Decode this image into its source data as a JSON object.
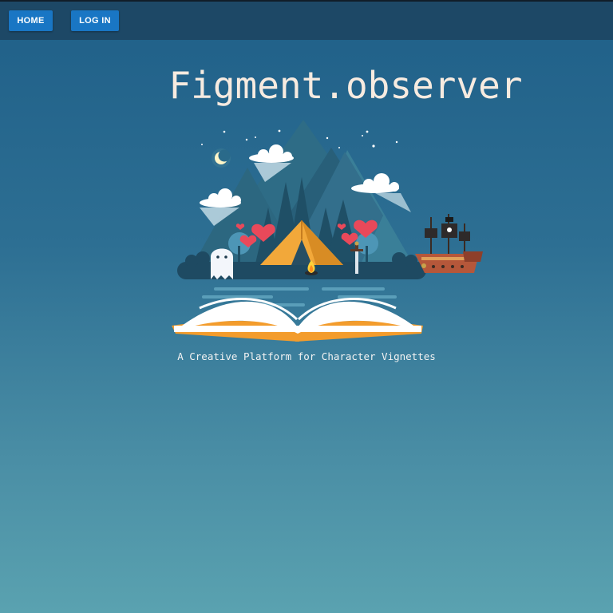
{
  "nav": {
    "home_label": "HOME",
    "login_label": "LOG IN"
  },
  "header": {
    "site_title": "Figment.observer"
  },
  "hero": {
    "tagline": "A Creative Platform for Character Vignettes"
  },
  "colors": {
    "topbar": "#1d4866",
    "button": "#1976c4",
    "title_text": "#f7ebe0",
    "tent": "#f2a83a",
    "book_cover": "#f39c2c",
    "heart": "#e9495a"
  },
  "icons": [
    "moon-icon",
    "star-icon",
    "cloud-icon",
    "tent-icon",
    "ghost-icon",
    "sword-icon",
    "campfire-icon",
    "pirate-ship-icon",
    "heart-icon",
    "book-icon"
  ]
}
